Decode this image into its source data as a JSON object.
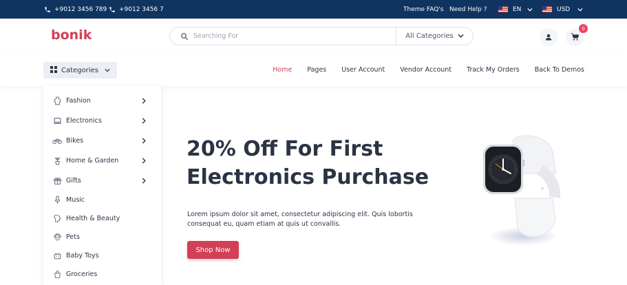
{
  "topbar": {
    "phone1": "+9012 3456 789",
    "phone2": "+9012 3456 7",
    "faq": "Theme FAQ's",
    "help": "Need Help ?",
    "language": "EN",
    "currency": "USD"
  },
  "header": {
    "logo": "bonik",
    "search_placeholder": "Searching For",
    "category_select": "All Categories",
    "cart_count": "0"
  },
  "nav": {
    "categories_button": "Categories",
    "links": [
      "Home",
      "Pages",
      "User Account",
      "Vendor Account",
      "Track My Orders",
      "Back To Demos"
    ],
    "active_link": "Home"
  },
  "sidebar": {
    "items": [
      {
        "label": "Fashion",
        "icon": "dress-icon"
      },
      {
        "label": "Electronics",
        "icon": "laptop-icon"
      },
      {
        "label": "Bikes",
        "icon": "bike-icon"
      },
      {
        "label": "Home & Garden",
        "icon": "plant-icon"
      },
      {
        "label": "Gifts",
        "icon": "gift-icon"
      },
      {
        "label": "Music",
        "icon": "microphone-icon"
      },
      {
        "label": "Health & Beauty",
        "icon": "health-icon"
      },
      {
        "label": "Pets",
        "icon": "paw-icon"
      },
      {
        "label": "Baby Toys",
        "icon": "toy-icon"
      },
      {
        "label": "Groceries",
        "icon": "grocery-icon"
      }
    ]
  },
  "hero": {
    "title_line1": "20% Off For First",
    "title_line2": "Electronics Purchase",
    "text": "Lorem ipsum dolor sit amet, consectetur adipiscing elit. Quis lobortis consequat eu, quam etiam at quis ut convallis.",
    "button": "Shop Now"
  },
  "colors": {
    "topbar": "#0f3460",
    "accent": "#d23f57",
    "badge": "#e94560",
    "text": "#2b3445"
  }
}
